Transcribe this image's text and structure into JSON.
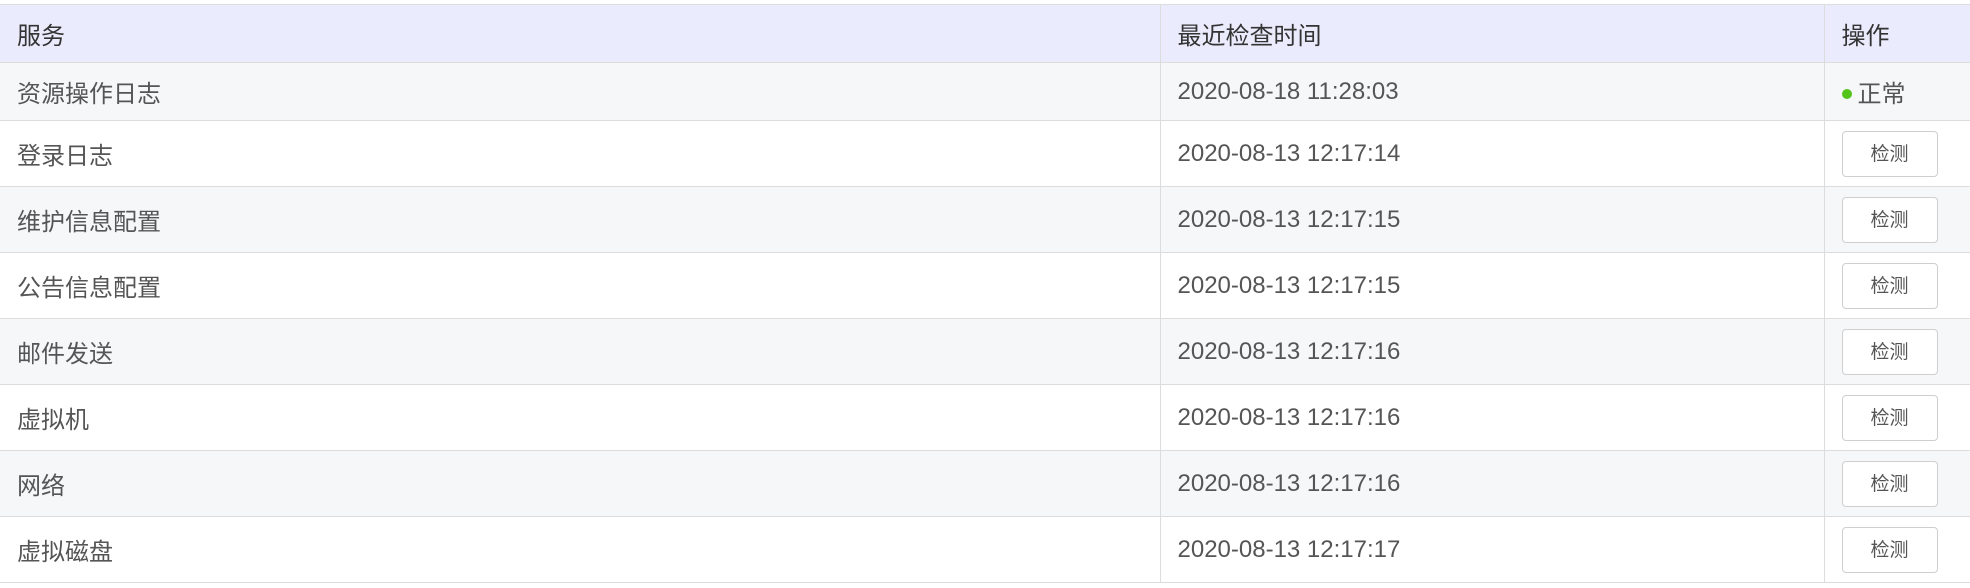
{
  "table": {
    "headers": {
      "service": "服务",
      "last_check": "最近检查时间",
      "action": "操作"
    },
    "status_color": "#52c41a",
    "rows": [
      {
        "service": "资源操作日志",
        "time": "2020-08-18 11:28:03",
        "status": "正常"
      },
      {
        "service": "登录日志",
        "time": "2020-08-13 12:17:14",
        "action": "检测"
      },
      {
        "service": "维护信息配置",
        "time": "2020-08-13 12:17:15",
        "action": "检测"
      },
      {
        "service": "公告信息配置",
        "time": "2020-08-13 12:17:15",
        "action": "检测"
      },
      {
        "service": "邮件发送",
        "time": "2020-08-13 12:17:16",
        "action": "检测"
      },
      {
        "service": "虚拟机",
        "time": "2020-08-13 12:17:16",
        "action": "检测"
      },
      {
        "service": "网络",
        "time": "2020-08-13 12:17:16",
        "action": "检测"
      },
      {
        "service": "虚拟磁盘",
        "time": "2020-08-13 12:17:17",
        "action": "检测"
      }
    ]
  }
}
